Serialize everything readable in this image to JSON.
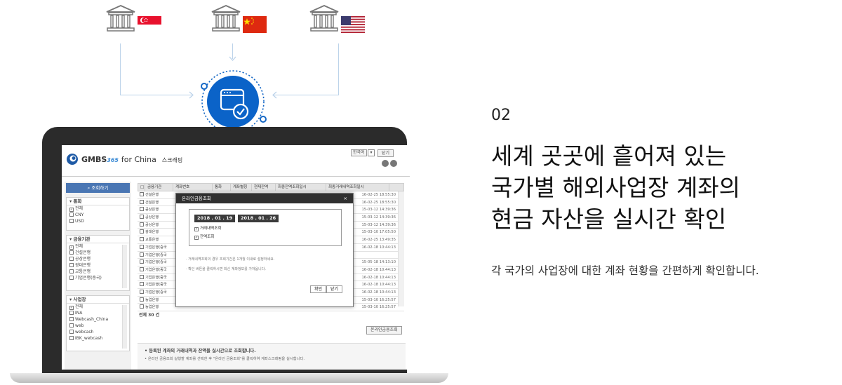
{
  "step": "02",
  "headline": [
    "세계 곳곳에 흩어져 있는",
    "국가별 해외사업장 계좌의",
    "현금 자산을 실시간 확인"
  ],
  "description": "각 국가의 사업장에 대한 계좌 현황을 간편하게 확인합니다.",
  "banks": [
    {
      "country": "singapore",
      "icon": "bank-icon"
    },
    {
      "country": "china",
      "icon": "bank-icon"
    },
    {
      "country": "usa",
      "icon": "bank-icon"
    }
  ],
  "app": {
    "logo": "GMBS",
    "logo_version": "365",
    "logo_suffix": "for China",
    "subtitle": "스크래핑",
    "language": "한국어",
    "close_label": "닫기",
    "search_label": "조회하기",
    "groups": [
      {
        "title": "통화",
        "items": [
          {
            "label": "전체",
            "checked": true
          },
          {
            "label": "CNY",
            "checked": false
          },
          {
            "label": "USD",
            "checked": false
          }
        ]
      },
      {
        "title": "금융기관",
        "items": [
          {
            "label": "전체",
            "checked": true
          },
          {
            "label": "건설은행",
            "checked": false
          },
          {
            "label": "공상은행",
            "checked": false
          },
          {
            "label": "광대은행",
            "checked": false
          },
          {
            "label": "교통은행",
            "checked": false
          },
          {
            "label": "기업은행(중국)",
            "checked": false
          }
        ]
      },
      {
        "title": "사업장",
        "items": [
          {
            "label": "전체",
            "checked": true
          },
          {
            "label": "INA",
            "checked": false
          },
          {
            "label": "Webcash_China",
            "checked": false
          },
          {
            "label": "web",
            "checked": false
          },
          {
            "label": "webcash",
            "checked": false
          },
          {
            "label": "IBK_webcash",
            "checked": false
          }
        ]
      }
    ],
    "table_headers": [
      "금융기관",
      "계좌번호",
      "통화",
      "계좌별칭",
      "현재잔액",
      "최종잔액조회일시",
      "최종거래내역조회일시"
    ],
    "rows": [
      {
        "bank": "건설은행",
        "date": "16-02-25 18:55:30"
      },
      {
        "bank": "건설은행",
        "date": "16-02-25 18:55:30"
      },
      {
        "bank": "공상은행",
        "date": "15-03-12 14:39:36"
      },
      {
        "bank": "공상은행",
        "date": "15-03-12 14:39:36"
      },
      {
        "bank": "공상은행",
        "date": "15-03-12 14:39:36"
      },
      {
        "bank": "광대은행",
        "date": "15-03-10 17:05:50"
      },
      {
        "bank": "교통은행",
        "date": "16-02-25 13:49:35"
      },
      {
        "bank": "기업은행(중국",
        "date": "16-02-18 10:44:13"
      },
      {
        "bank": "기업은행(중국",
        "date": ""
      },
      {
        "bank": "기업은행(중국",
        "date": "15-05-18 14:13:10"
      },
      {
        "bank": "기업은행(중국",
        "date": "16-02-18 10:44:13"
      },
      {
        "bank": "기업은행(중국",
        "date": "16-02-18 10:44:13"
      },
      {
        "bank": "기업은행(중국",
        "date": "16-02-18 10:44:13"
      },
      {
        "bank": "기업은행(중국",
        "date": "16-02-18 10:44:13"
      },
      {
        "bank": "농업은행",
        "date": "15-03-10 16:25:57"
      },
      {
        "bank": "농업은행",
        "date": "15-03-10 16:25:57"
      }
    ],
    "total": "전체 30 건",
    "online_query_button": "온라인금융조회",
    "notice_title": "등록된 계좌의 거래내역과 잔액을 실시간으로 조회합니다.",
    "notice_sub": "온라인 금융조회 실행할 계좌를 선택한 후 \"온라인 금융조회\"를 클릭하여 계좌스크래핑을 실시합니다.",
    "modal": {
      "title": "온라인금융조회",
      "close": "×",
      "date_from": "2018 . 01 . 19",
      "date_sep": "-",
      "date_to": "2018 . 01 . 26",
      "opt1": "거래내역조회",
      "opt2": "잔액조회",
      "note1": "· 거래내역조회의 경우 조회기간은 1개월 이내로 설정하세요.",
      "note2": "· 확인 버튼을 클릭하시면 최신 계좌정보를 가져옵니다.",
      "ok": "확인",
      "cancel": "닫기"
    }
  }
}
